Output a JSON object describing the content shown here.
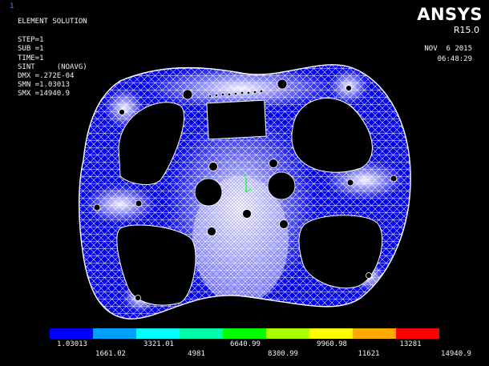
{
  "viewport": {
    "window_number": "1",
    "header": {
      "title": "ELEMENT SOLUTION",
      "lines": [
        "STEP=1",
        "SUB =1",
        "TIME=1",
        "SINT     (NOAVG)",
        "DMX =.272E-04",
        "SMN =1.03013",
        "SMX =14940.9"
      ]
    },
    "logo": "ANSYS",
    "version": "R15.0",
    "date": "NOV  6 2015",
    "time": "06:48:29"
  },
  "legend": {
    "colors": [
      "#0000ff",
      "#00a0ff",
      "#00ffff",
      "#00ffaa",
      "#00ff00",
      "#aaff00",
      "#ffff00",
      "#ffaa00",
      "#ff0000"
    ],
    "values_top": [
      "1.03013",
      "3321.01",
      "6640.99",
      "9960.98",
      "13281"
    ],
    "values_bottom": [
      "1661.02",
      "4981",
      "8300.99",
      "11621",
      "14940.9"
    ]
  },
  "model": {
    "mesh_color": "#0000ff",
    "line_color": "#ffffff"
  }
}
